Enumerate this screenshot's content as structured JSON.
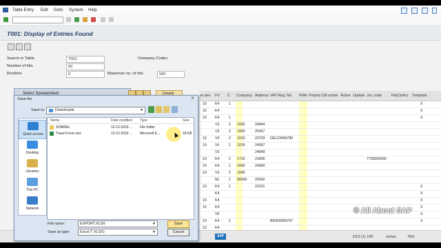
{
  "menu": [
    "Table Entry",
    "Edit",
    "Goto",
    "System",
    "Help"
  ],
  "title": "T001: Display of Entries Found",
  "form": {
    "search_label": "Search in Table",
    "search_value": "T001",
    "search_desc": "Company Codes",
    "hits_label": "Number of hits",
    "hits_value": "83",
    "runtime_label": "Runtime",
    "runtime_value": "0",
    "maxhits_label": "Maximum no. of hits",
    "maxhits_value": "500"
  },
  "grid": {
    "headers": [
      "ex.dev",
      "FV",
      "C",
      "Company",
      "Address",
      "VAT Reg. No.",
      "FMA",
      "Project CM active",
      "Active",
      "Update",
      "Jur. code",
      "FdsCtrAct.",
      "Template"
    ],
    "rows": [
      [
        "10",
        "K4",
        "1",
        "",
        "",
        "",
        "",
        "",
        "",
        "",
        "",
        "",
        "X"
      ],
      [
        "10",
        "K4",
        "",
        "",
        "",
        "",
        "",
        "",
        "",
        "",
        "",
        "",
        "X"
      ],
      [
        "10",
        "K4",
        "1",
        "",
        "",
        "",
        "",
        "",
        "",
        "",
        "",
        "",
        "X"
      ],
      [
        "",
        "V3",
        "2",
        "1000",
        "24944",
        "",
        "",
        "",
        "",
        "",
        "",
        "",
        ""
      ],
      [
        "",
        "V3",
        "2",
        "1000",
        "25067",
        "",
        "",
        "",
        "",
        "",
        "",
        "",
        ""
      ],
      [
        "10",
        "V3",
        "2",
        "1010",
        "23729",
        "DE123456789",
        "",
        "",
        "",
        "",
        "",
        "",
        ""
      ],
      [
        "10",
        "14",
        "1",
        "1019",
        "24967",
        "",
        "",
        "",
        "",
        "",
        "",
        "",
        ""
      ],
      [
        "",
        "V3",
        "",
        "",
        "24949",
        "",
        "",
        "",
        "",
        "",
        "",
        "",
        ""
      ],
      [
        "10",
        "K4",
        "2",
        "1710",
        "23406",
        "",
        "",
        "",
        "",
        "",
        "7700000000",
        "",
        ""
      ],
      [
        "10",
        "K4",
        "1",
        "2000",
        "24960",
        "",
        "",
        "",
        "",
        "",
        "",
        "",
        ""
      ],
      [
        "10",
        "V3",
        "2",
        "1000",
        "",
        "",
        "",
        "",
        "",
        "",
        "",
        "",
        ""
      ],
      [
        "",
        "56",
        "1",
        "56565",
        "25092",
        "",
        "",
        "",
        "",
        "",
        "",
        "",
        ""
      ],
      [
        "10",
        "K4",
        "1",
        "",
        "22231",
        "",
        "",
        "",
        "",
        "",
        "",
        "",
        "X"
      ],
      [
        "",
        "K4",
        "",
        "",
        "",
        "",
        "",
        "",
        "",
        "",
        "",
        "",
        "X"
      ],
      [
        "10",
        "K4",
        "",
        "",
        "",
        "",
        "",
        "",
        "",
        "",
        "",
        "",
        "X"
      ],
      [
        "10",
        "K4",
        "",
        "",
        "",
        "",
        "",
        "",
        "",
        "",
        "",
        "",
        "X"
      ],
      [
        "",
        "V6",
        "",
        "",
        "",
        "",
        "",
        "",
        "",
        "",
        "",
        "",
        "X"
      ],
      [
        "10",
        "K4",
        "2",
        "",
        "",
        "BE000009797",
        "",
        "",
        "",
        "",
        "",
        "",
        "X"
      ],
      [
        "10",
        "K4",
        "",
        "",
        "",
        "",
        "",
        "",
        "",
        "",
        "",
        "",
        ""
      ]
    ]
  },
  "dialog_select": {
    "title": "Select Spreadsheet",
    "details_label": "Details"
  },
  "save_as": {
    "title": "Save As",
    "save_in_label": "Save in:",
    "save_in_value": "Downloads",
    "columns": [
      "Name",
      "Date modified",
      "Type",
      "Size"
    ],
    "files": [
      {
        "name": "SHAREit",
        "date": "12-12-2019 ...",
        "type": "File folder",
        "size": ""
      },
      {
        "name": "Travel Form.xlsx",
        "date": "12-12-2019 ...",
        "type": "Microsoft E...",
        "size": "18 KB"
      }
    ],
    "places": [
      "Quick access",
      "Desktop",
      "Libraries",
      "This PC",
      "Network"
    ],
    "filename_label": "File name:",
    "filename_value": "EXPORT.XLSX",
    "filetype_label": "Save as type:",
    "filetype_value": "Excel (*.XLSX)",
    "save_label": "Save",
    "cancel_label": "Cancel"
  },
  "status": {
    "sap_logo": "SAP",
    "system": "D19 (1) 100",
    "server": "verius",
    "mode": "INS"
  },
  "watermark": "© All About SAP"
}
